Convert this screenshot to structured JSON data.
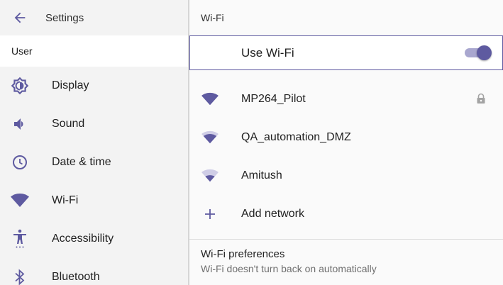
{
  "left": {
    "title": "Settings",
    "user_label": "User",
    "items": [
      {
        "label": "Display",
        "icon": "display-brightness-icon"
      },
      {
        "label": "Sound",
        "icon": "volume-icon"
      },
      {
        "label": "Date & time",
        "icon": "clock-icon"
      },
      {
        "label": "Wi-Fi",
        "icon": "wifi-icon"
      },
      {
        "label": "Accessibility",
        "icon": "accessibility-icon"
      },
      {
        "label": "Bluetooth",
        "icon": "bluetooth-icon"
      }
    ]
  },
  "right": {
    "title": "Wi-Fi",
    "master": {
      "label": "Use Wi-Fi",
      "enabled": true
    },
    "networks": [
      {
        "name": "MP264_Pilot",
        "secured": true,
        "icon": "wifi-signal-full-icon"
      },
      {
        "name": "QA_automation_DMZ",
        "secured": false,
        "icon": "wifi-signal-high-icon"
      },
      {
        "name": "Amitush",
        "secured": false,
        "icon": "wifi-signal-medium-icon"
      }
    ],
    "add_network_label": "Add network",
    "preferences": {
      "title": "Wi-Fi preferences",
      "subtitle": "Wi-Fi doesn't turn back on automatically"
    }
  },
  "colors": {
    "accent": "#5e5aa0",
    "accent_light": "#a9a7cf",
    "left_pane_bg": "#f3f3f3",
    "right_pane_bg": "#fafafa"
  }
}
